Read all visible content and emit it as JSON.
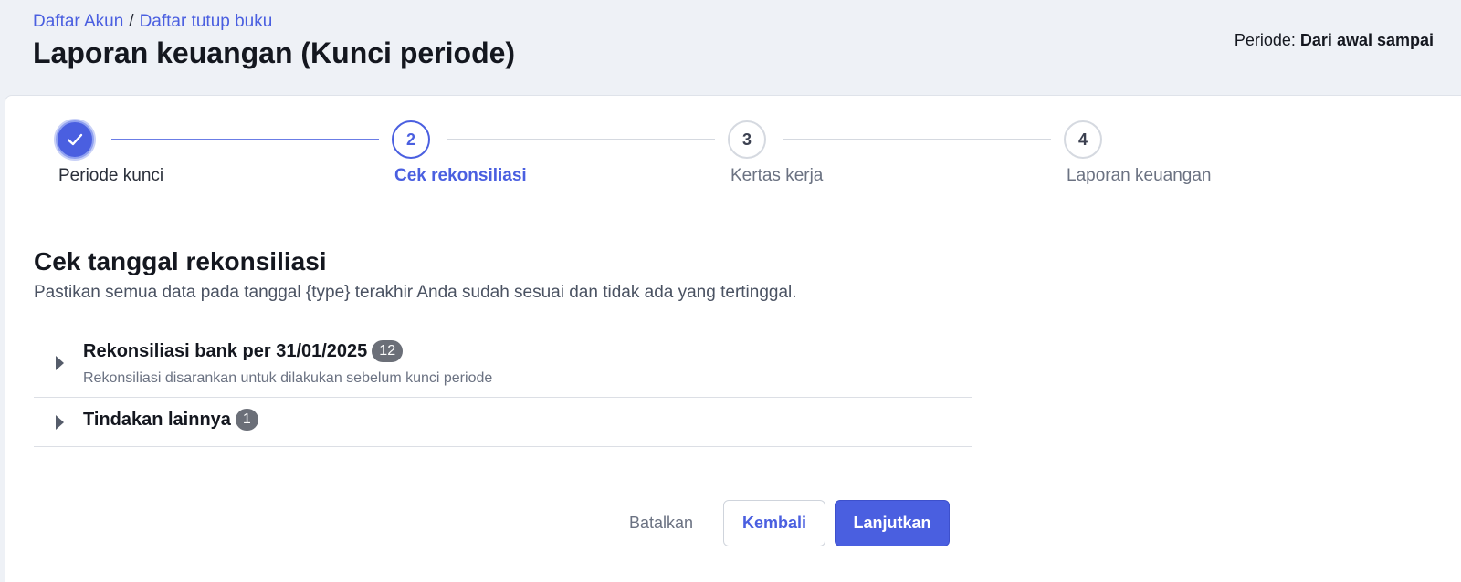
{
  "breadcrumb": {
    "items": [
      "Daftar Akun",
      "Daftar tutup buku"
    ],
    "separator": "/"
  },
  "page_title": "Laporan keuangan (Kunci periode)",
  "periode": {
    "label": "Periode:",
    "value": "Dari awal sampai"
  },
  "stepper": {
    "steps": [
      {
        "number": "",
        "label": "Periode kunci",
        "state": "done",
        "icon": "check-icon"
      },
      {
        "number": "2",
        "label": "Cek rekonsiliasi",
        "state": "active"
      },
      {
        "number": "3",
        "label": "Kertas kerja",
        "state": "idle"
      },
      {
        "number": "4",
        "label": "Laporan keuangan",
        "state": "idle"
      }
    ]
  },
  "section": {
    "title": "Cek tanggal rekonsiliasi",
    "description": "Pastikan semua data pada tanggal {type} terakhir Anda sudah sesuai dan tidak ada yang tertinggal."
  },
  "accordion": [
    {
      "title": "Rekonsiliasi bank per 31/01/2025",
      "badge": "12",
      "subtitle": "Rekonsiliasi disarankan untuk dilakukan sebelum kunci periode"
    },
    {
      "title": "Tindakan lainnya",
      "badge": "1",
      "subtitle": ""
    }
  ],
  "actions": {
    "cancel": "Batalkan",
    "back": "Kembali",
    "next": "Lanjutkan"
  },
  "colors": {
    "accent": "#4a5fe0",
    "page_bg": "#eef1f6",
    "badge": "#6b6f78"
  }
}
